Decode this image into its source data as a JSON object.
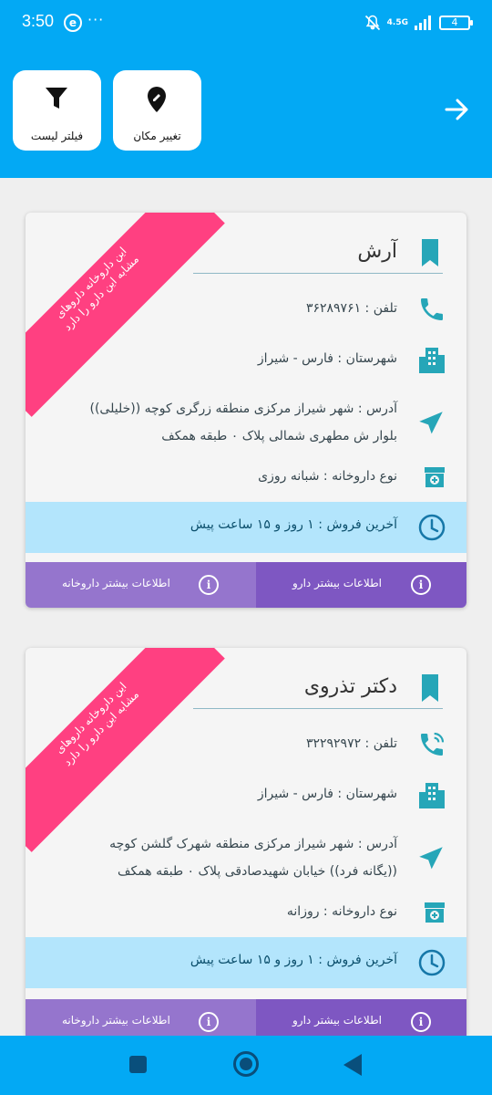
{
  "status_bar": {
    "time": "3:50",
    "app_icon_glyph": "e",
    "dots": "···",
    "network": "4.5G",
    "battery": "4"
  },
  "header": {
    "filter_label": "فیلتر لیست",
    "change_location_label": "تغییر مکان"
  },
  "pharmacies": [
    {
      "ribbon_line1": "این داروخانه داروهای",
      "ribbon_line2": "مشابه این دارو را دارد",
      "name": "آرش",
      "phone": "تلفن : ۳۶۲۸۹۷۶۱",
      "city": "شهرستان : فارس - شیراز",
      "address_line1": "آدرس : شهر شیراز مرکزی منطقه زرگری کوچه ((خلیلی))",
      "address_line2": "بلوار ش مطهری شمالی پلاک ۰ طبقه همکف",
      "type": "نوع داروخانه : شبانه روزی",
      "last_sale": "آخرین فروش : ۱ روز و ۱۵ ساعت پیش",
      "drug_info_button": "اطلاعات بیشتر دارو",
      "pharmacy_info_button": "اطلاعات بیشتر داروخانه",
      "phone_icon": "phone-icon"
    },
    {
      "ribbon_line1": "این داروخانه داروهای",
      "ribbon_line2": "مشابه این دارو را دارد",
      "name": "دکتر تذروی",
      "phone": "تلفن : ۳۲۲۹۲۹۷۲",
      "city": "شهرستان : فارس - شیراز",
      "address_line1": "آدرس : شهر شیراز مرکزی منطقه شهرک گلشن کوچه",
      "address_line2": "((یگانه فرد)) خیابان شهیدصادقی پلاک ۰ طبقه همکف",
      "type": "نوع داروخانه : روزانه",
      "last_sale": "آخرین فروش : ۱ روز و ۱۵ ساعت پیش",
      "drug_info_button": "اطلاعات بیشتر دارو",
      "pharmacy_info_button": "اطلاعات بیشتر داروخانه",
      "phone_icon": "phone-in-talk-icon"
    }
  ],
  "colors": {
    "primary": "#03a9f4",
    "ribbon": "#ff4081",
    "icon_teal": "#26a6b8",
    "sale_band": "#b3e5fc",
    "button_drug": "#7e57c2",
    "button_pharmacy": "#9575cd"
  }
}
